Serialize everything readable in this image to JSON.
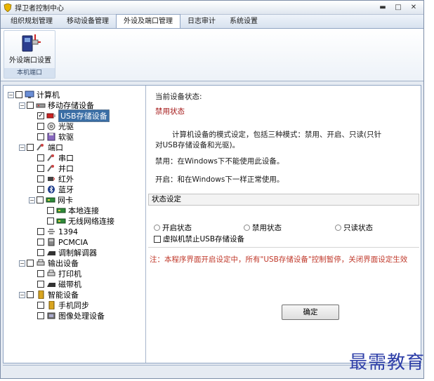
{
  "window": {
    "title": "捍卫者控制中心",
    "min_label": "▬",
    "max_label": "□",
    "close_label": "✕"
  },
  "tabs": [
    {
      "label": "组织规划管理"
    },
    {
      "label": "移动设备管理"
    },
    {
      "label": "外设及端口管理"
    },
    {
      "label": "日志审计"
    },
    {
      "label": "系统设置"
    }
  ],
  "ribbon": {
    "button_label": "外设端口设置",
    "group_title": "本机端口"
  },
  "tree": {
    "computer": "计算机",
    "mobile_storage": "移动存储设备",
    "usb_storage": "USB存储设备",
    "cdrom": "光驱",
    "floppy": "软驱",
    "ports": "端口",
    "serial": "串口",
    "parallel": "并口",
    "infrared": "红外",
    "bluetooth": "蓝牙",
    "nic": "网卡",
    "local_conn": "本地连接",
    "wireless_conn": "无线网络连接",
    "ieee1394": "1394",
    "pcmcia": "PCMCIA",
    "modem": "调制解调器",
    "output": "输出设备",
    "printer": "打印机",
    "tape": "磁带机",
    "smart": "智能设备",
    "phone_sync": "手机同步",
    "imaging": "图像处理设备"
  },
  "panel": {
    "current_status_label": "当前设备状态:",
    "current_status_value": "禁用状态",
    "desc_line1": "计算机设备的模式设定，包括三种模式：禁用、开启、只读(只针",
    "desc_line2": "对USB存储设备和光驱)。",
    "disable_desc": "禁用：在Windows下不能使用此设备。",
    "enable_desc": "开启：和在Windows下一样正常使用。",
    "section_title": "状态设定",
    "radio_enable": "开启状态",
    "radio_disable": "禁用状态",
    "radio_readonly": "只读状态",
    "vm_checkbox": "虚拟机禁止USB存储设备",
    "note": "注：本程序界面开启设定中，所有\"USB存储设备\"控制暂停，关闭界面设定生效",
    "ok_button": "确定"
  },
  "watermark": "最需教育",
  "colors": {
    "selection": "#3a6ea5",
    "status_red": "#a31515",
    "note_red": "#c0392b",
    "watermark": "#2e3fa8"
  }
}
